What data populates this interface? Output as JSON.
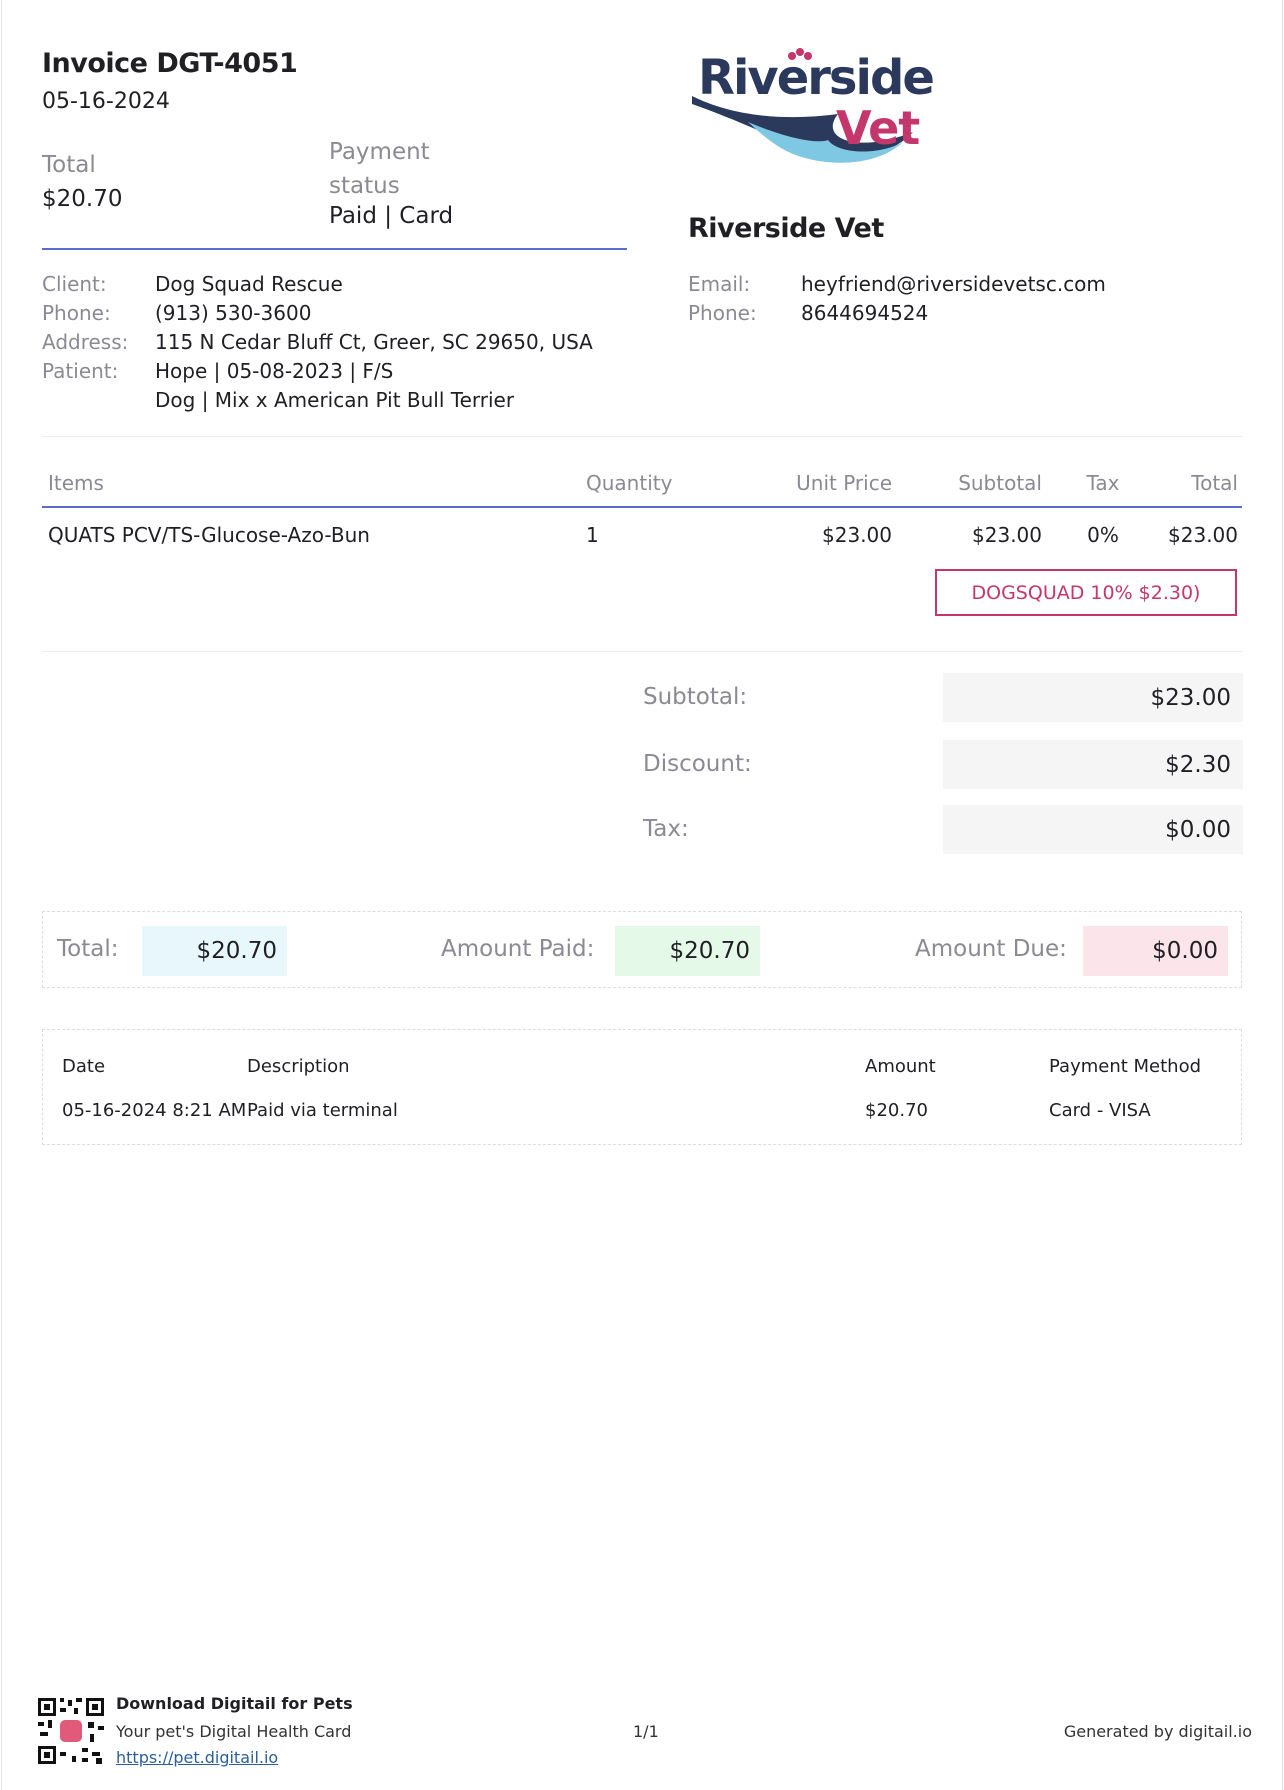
{
  "invoice": {
    "title": "Invoice DGT-4051",
    "date": "05-16-2024",
    "total_label": "Total",
    "total_value": "$20.70",
    "payment_status_label_1": "Payment",
    "payment_status_label_2": "status",
    "payment_status_value": "Paid | Card"
  },
  "brand": {
    "logo_line1": "Riverside",
    "logo_line2": "Vet",
    "name": "Riverside Vet",
    "colors": {
      "navy": "#2b3a5c",
      "pink": "#c4376c",
      "light_blue": "#7fc8e4",
      "accent_line": "#5a6bc8"
    }
  },
  "client": {
    "labels": {
      "client": "Client:",
      "phone": "Phone:",
      "address": "Address:",
      "patient": "Patient:"
    },
    "name": "Dog Squad Rescue",
    "phone": "(913) 530-3600",
    "address": "115 N Cedar Bluff Ct, Greer, SC 29650, USA",
    "patient_line1": "Hope | 05-08-2023 | F/S",
    "patient_line2": "Dog | Mix x American Pit Bull Terrier"
  },
  "clinic": {
    "labels": {
      "email": "Email:",
      "phone": "Phone:"
    },
    "email": "heyfriend@riversidevetsc.com",
    "phone": "8644694524"
  },
  "items_table": {
    "headers": {
      "items": "Items",
      "quantity": "Quantity",
      "unit_price": "Unit Price",
      "subtotal": "Subtotal",
      "tax": "Tax",
      "total": "Total"
    },
    "rows": [
      {
        "item": "QUATS PCV/TS-Glucose-Azo-Bun",
        "quantity": "1",
        "unit_price": "$23.00",
        "subtotal": "$23.00",
        "tax": "0%",
        "total": "$23.00"
      }
    ],
    "discount_tag": "DOGSQUAD 10% $2.30)"
  },
  "summary": {
    "subtotal_label": "Subtotal:",
    "subtotal_value": "$23.00",
    "discount_label": "Discount:",
    "discount_value": "$2.30",
    "tax_label": "Tax:",
    "tax_value": "$0.00"
  },
  "totals": {
    "total_label": "Total:",
    "total_value": "$20.70",
    "paid_label": "Amount Paid:",
    "paid_value": "$20.70",
    "due_label": "Amount Due:",
    "due_value": "$0.00"
  },
  "payments": {
    "headers": {
      "date": "Date",
      "description": "Description",
      "amount": "Amount",
      "method": "Payment Method"
    },
    "rows": [
      {
        "date": "05-16-2024 8:21 AM",
        "description": "Paid via terminal",
        "amount": "$20.70",
        "method": "Card - VISA"
      }
    ]
  },
  "footer": {
    "app_title": "Download Digitail for Pets",
    "app_subtitle": "Your pet's Digital Health Card",
    "app_link": "https://pet.digitail.io",
    "page": "1/1",
    "generated_by": "Generated by digitail.io"
  }
}
